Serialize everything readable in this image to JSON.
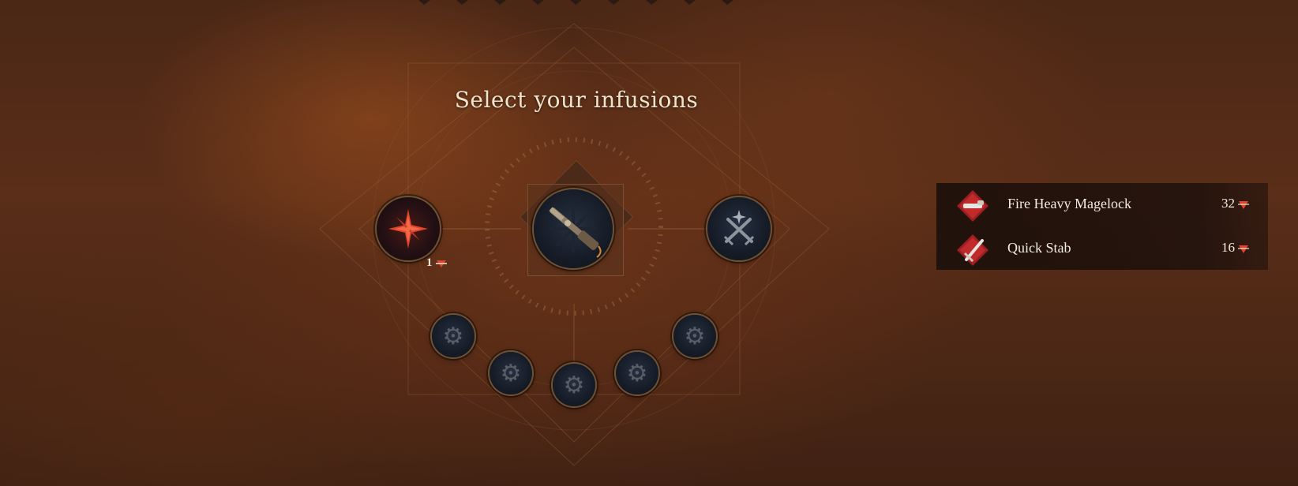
{
  "title": "Select your infusions",
  "colors": {
    "accent_red": "#e0442c",
    "gold_line": "#b08050",
    "slot_dark": "#161c27"
  },
  "left_infusion": {
    "icon": "red-star-burst-icon",
    "count": "1"
  },
  "center_weapon": {
    "icon": "magelock-rifle-icon"
  },
  "right_slot": {
    "icon": "crossed-swords-icon"
  },
  "gear_slots": [
    {
      "icon": "gear-icon"
    },
    {
      "icon": "gear-icon"
    },
    {
      "icon": "gear-icon"
    },
    {
      "icon": "gear-icon"
    },
    {
      "icon": "gear-icon"
    }
  ],
  "infusion_list": [
    {
      "label": "Fire Heavy Magelock",
      "cost": "32",
      "icon": "magelock-icon"
    },
    {
      "label": "Quick Stab",
      "cost": "16",
      "icon": "dagger-icon"
    }
  ]
}
